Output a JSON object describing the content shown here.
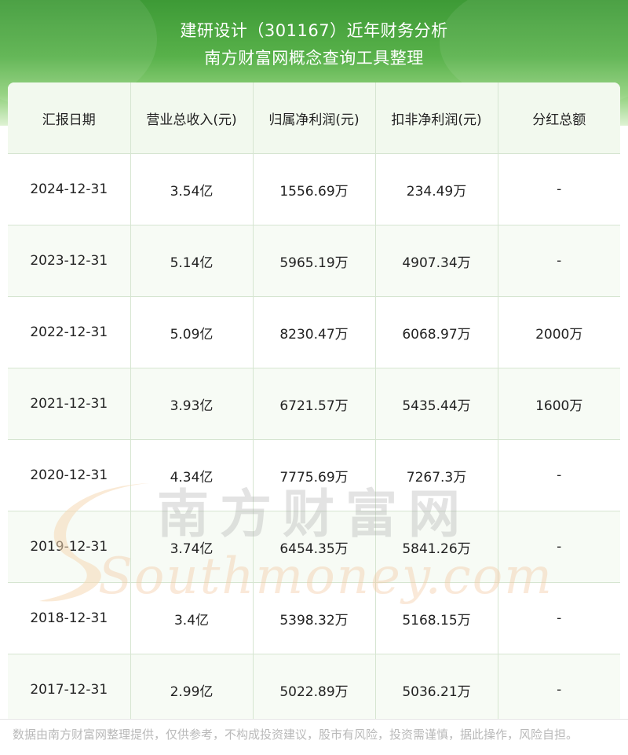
{
  "header": {
    "title_line1": "建研设计（301167）近年财务分析",
    "title_line2": "南方财富网概念查询工具整理"
  },
  "table": {
    "columns": [
      "汇报日期",
      "营业总收入(元)",
      "归属净利润(元)",
      "扣非净利润(元)",
      "分红总额"
    ],
    "rows": [
      [
        "2024-12-31",
        "3.54亿",
        "1556.69万",
        "234.49万",
        "-"
      ],
      [
        "2023-12-31",
        "5.14亿",
        "5965.19万",
        "4907.34万",
        "-"
      ],
      [
        "2022-12-31",
        "5.09亿",
        "8230.47万",
        "6068.97万",
        "2000万"
      ],
      [
        "2021-12-31",
        "3.93亿",
        "6721.57万",
        "5435.44万",
        "1600万"
      ],
      [
        "2020-12-31",
        "4.34亿",
        "7775.69万",
        "7267.3万",
        "-"
      ],
      [
        "2019-12-31",
        "3.74亿",
        "6454.35万",
        "5841.26万",
        "-"
      ],
      [
        "2018-12-31",
        "3.4亿",
        "5398.32万",
        "5168.15万",
        "-"
      ],
      [
        "2017-12-31",
        "2.99亿",
        "5022.89万",
        "5036.21万",
        "-"
      ]
    ]
  },
  "watermark": {
    "cn": "南方财富网",
    "en": "Southmoney.com"
  },
  "footer": {
    "disclaimer": "数据由南方财富网整理提供，仅供参考，不构成投资建议，股市有风险，投资需谨慎，据此操作，风险自担。"
  },
  "colors": {
    "header_green": "#3d9a36",
    "header_light": "#8fd07a",
    "border": "#d6e5d1",
    "header_row_bg": "#f2f9ee"
  }
}
